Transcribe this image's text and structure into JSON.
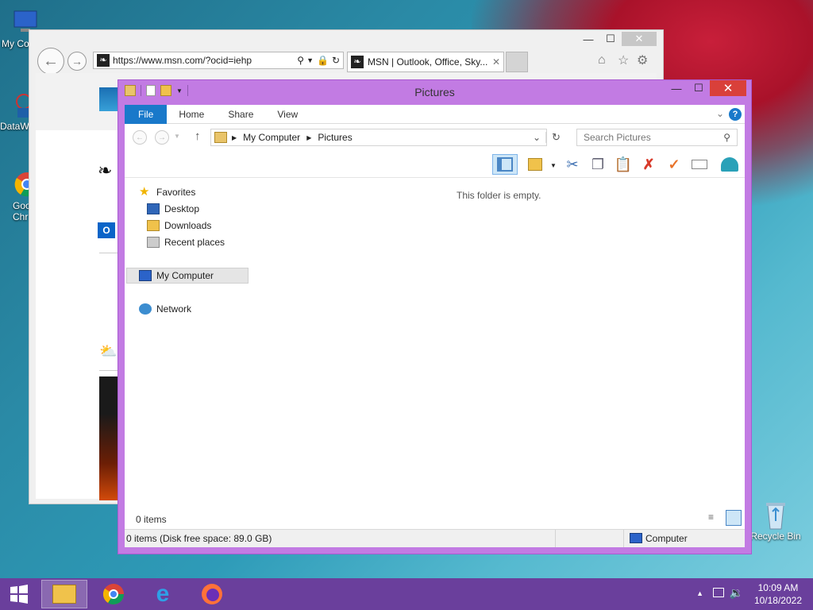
{
  "desktop": {
    "icons": [
      {
        "label": "My Co",
        "icon": "computer-icon"
      },
      {
        "label": "DataW",
        "icon": "app-icon"
      },
      {
        "label": "Goo\nChr",
        "icon": "chrome-icon"
      },
      {
        "label": "Recycle Bin",
        "icon": "recycle-bin-icon"
      }
    ]
  },
  "ie": {
    "url": "https://www.msn.com/?ocid=iehp",
    "tab_title": "MSN | Outlook, Office, Sky...",
    "minimize": "—",
    "maximize": "☐",
    "close": "✕"
  },
  "explorer": {
    "title": "Pictures",
    "ribbon_tabs": [
      "File",
      "Home",
      "Share",
      "View"
    ],
    "breadcrumb": [
      "My Computer",
      "Pictures"
    ],
    "search_placeholder": "Search Pictures",
    "favorites_label": "Favorites",
    "favorites": [
      "Desktop",
      "Downloads",
      "Recent places"
    ],
    "my_computer": "My Computer",
    "network": "Network",
    "empty_message": "This folder is empty.",
    "item_count": "0 items",
    "status_text": "0 items (Disk free space: 89.0 GB)",
    "status_location": "Computer"
  },
  "taskbar": {
    "time": "10:09 AM",
    "date": "10/18/2022",
    "apps": [
      "file-explorer-icon",
      "chrome-icon",
      "internet-explorer-icon",
      "firefox-icon"
    ]
  },
  "colors": {
    "explorer_frame": "#c27be3",
    "taskbar": "#6a3f9c",
    "file_tab": "#1979ca",
    "close_button": "#d9403a"
  }
}
